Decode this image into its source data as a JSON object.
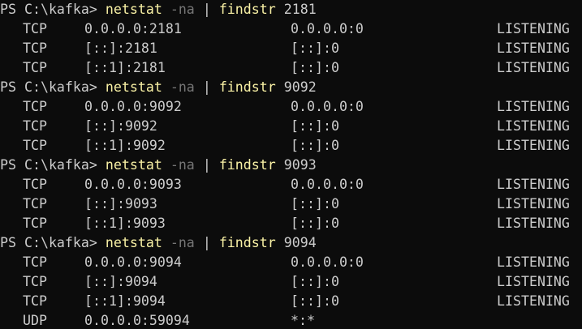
{
  "terminal": {
    "colors": {
      "background": "#0c0c0c",
      "text": "#cccccc",
      "command": "#f9f1a5",
      "flag": "#767676"
    },
    "blocks": [
      {
        "prompt": "PS C:\\kafka>",
        "command": "netstat",
        "flag": "-na",
        "pipe": "|",
        "filter": "findstr",
        "filter_arg": "2181",
        "rows": [
          {
            "proto": "TCP",
            "local": "0.0.0.0:2181",
            "foreign": "0.0.0.0:0",
            "state": "LISTENING"
          },
          {
            "proto": "TCP",
            "local": "[::]:2181",
            "foreign": "[::]:0",
            "state": "LISTENING"
          },
          {
            "proto": "TCP",
            "local": "[::1]:2181",
            "foreign": "[::]:0",
            "state": "LISTENING"
          }
        ]
      },
      {
        "prompt": "PS C:\\kafka>",
        "command": "netstat",
        "flag": "-na",
        "pipe": "|",
        "filter": "findstr",
        "filter_arg": "9092",
        "rows": [
          {
            "proto": "TCP",
            "local": "0.0.0.0:9092",
            "foreign": "0.0.0.0:0",
            "state": "LISTENING"
          },
          {
            "proto": "TCP",
            "local": "[::]:9092",
            "foreign": "[::]:0",
            "state": "LISTENING"
          },
          {
            "proto": "TCP",
            "local": "[::1]:9092",
            "foreign": "[::]:0",
            "state": "LISTENING"
          }
        ]
      },
      {
        "prompt": "PS C:\\kafka>",
        "command": "netstat",
        "flag": "-na",
        "pipe": "|",
        "filter": "findstr",
        "filter_arg": "9093",
        "rows": [
          {
            "proto": "TCP",
            "local": "0.0.0.0:9093",
            "foreign": "0.0.0.0:0",
            "state": "LISTENING"
          },
          {
            "proto": "TCP",
            "local": "[::]:9093",
            "foreign": "[::]:0",
            "state": "LISTENING"
          },
          {
            "proto": "TCP",
            "local": "[::1]:9093",
            "foreign": "[::]:0",
            "state": "LISTENING"
          }
        ]
      },
      {
        "prompt": "PS C:\\kafka>",
        "command": "netstat",
        "flag": "-na",
        "pipe": "|",
        "filter": "findstr",
        "filter_arg": "9094",
        "rows": [
          {
            "proto": "TCP",
            "local": "0.0.0.0:9094",
            "foreign": "0.0.0.0:0",
            "state": "LISTENING"
          },
          {
            "proto": "TCP",
            "local": "[::]:9094",
            "foreign": "[::]:0",
            "state": "LISTENING"
          },
          {
            "proto": "TCP",
            "local": "[::1]:9094",
            "foreign": "[::]:0",
            "state": "LISTENING"
          },
          {
            "proto": "UDP",
            "local": "0.0.0.0:59094",
            "foreign": "*:*",
            "state": ""
          }
        ]
      }
    ]
  }
}
